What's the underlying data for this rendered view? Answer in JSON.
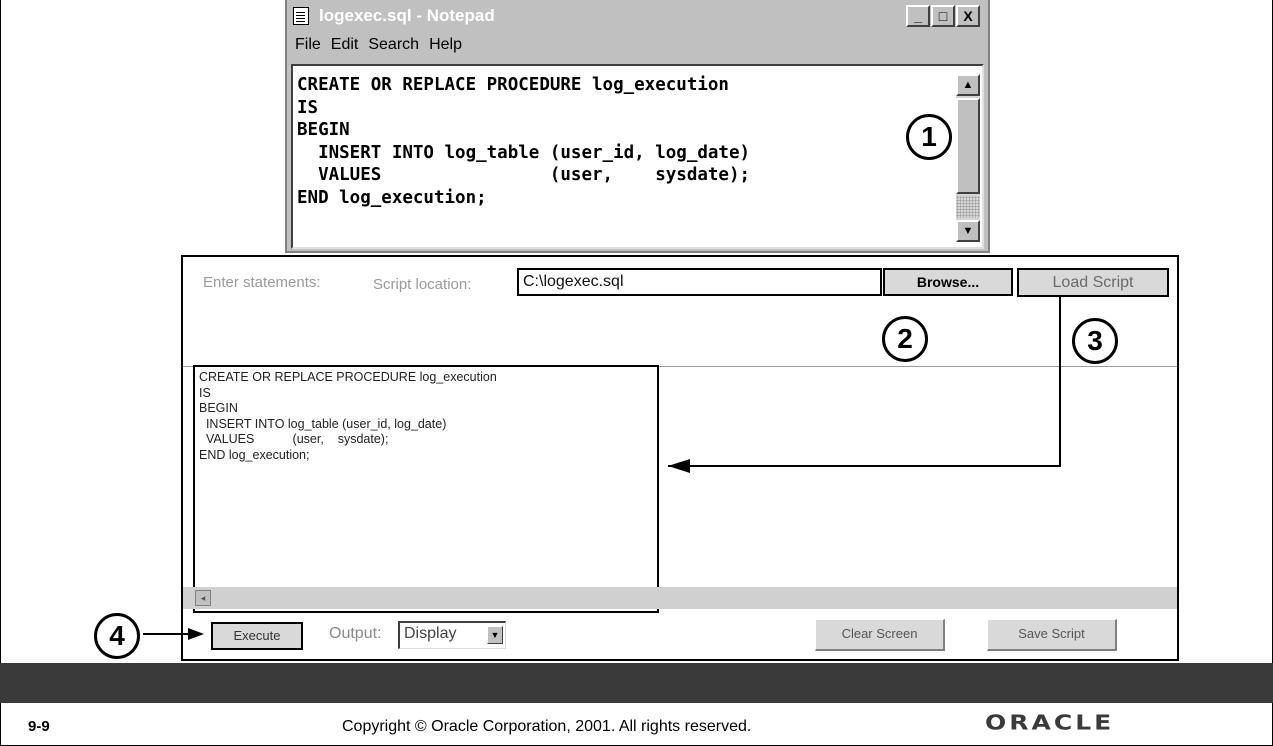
{
  "notepad": {
    "title": "logexec.sql - Notepad",
    "window_buttons": [
      "_",
      "□",
      "X"
    ],
    "menu": [
      "File",
      "Edit",
      "Search",
      "Help"
    ],
    "code": "CREATE OR REPLACE PROCEDURE log_execution\nIS\nBEGIN\n  INSERT INTO log_table (user_id, log_date)\n  VALUES                (user,    sysdate);\nEND log_execution;",
    "scroll_up": "▲",
    "scroll_down": "▼"
  },
  "isql": {
    "enter_statements_label": "Enter statements:",
    "script_location_label": "Script location:",
    "script_location_value": "C:\\logexec.sql",
    "browse_label": "Browse...",
    "load_script_label": "Load Script",
    "code": "CREATE OR REPLACE PROCEDURE log_execution\nIS\nBEGIN\n  INSERT INTO log_table (user_id, log_date)\n  VALUES           (user,    sysdate);\nEND log_execution;",
    "scroll_left": "◂",
    "execute_label": "Execute",
    "output_label": "Output:",
    "output_value": "Display",
    "select_arrow": "▼",
    "clear_screen_label": "Clear Screen",
    "save_script_label": "Save Script"
  },
  "callouts": [
    "1",
    "2",
    "3",
    "4"
  ],
  "footer": {
    "logo": "ORACLE",
    "page_number": "9-9",
    "copyright": "Copyright © Oracle Corporation, 2001. All rights reserved."
  },
  "colors": {
    "footer_bar": "#3a3a3a",
    "window_face": "#c0c0c0",
    "button_face": "#d9d9d9"
  }
}
